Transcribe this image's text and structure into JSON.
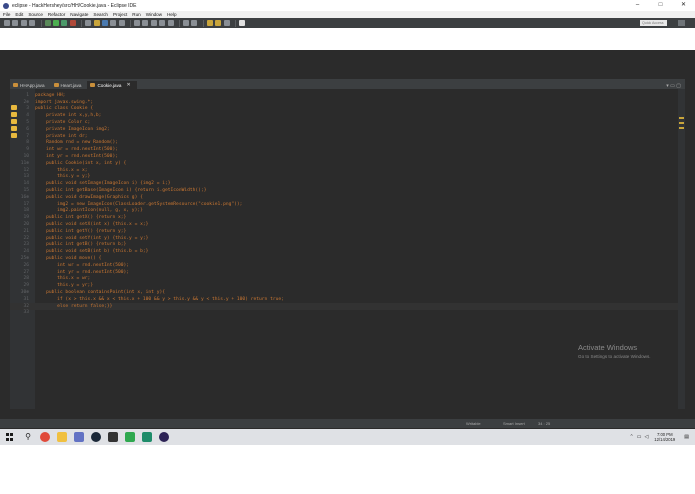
{
  "window": {
    "title": "eclipse - HackHershey/src/HH/Cookie.java - Eclipse IDE",
    "minimize": "–",
    "maximize": "□",
    "close": "✕"
  },
  "menu": [
    "File",
    "Edit",
    "Source",
    "Refactor",
    "Navigate",
    "Search",
    "Project",
    "Run",
    "Window",
    "Help"
  ],
  "toolbar": {
    "quick_access": "Quick Access"
  },
  "tabs": [
    {
      "label": "HHApp.java",
      "active": false
    },
    {
      "label": "Heart.java",
      "active": false
    },
    {
      "label": "Cookie.java",
      "active": true,
      "close": "✕"
    }
  ],
  "tab_controls": "▾ ▭ ▢",
  "code_lines": [
    {
      "num": "1",
      "text": "package HH;"
    },
    {
      "num": "2⊕",
      "text": "import javax.swing.*;"
    },
    {
      "num": "3",
      "text": "public class Cookie {"
    },
    {
      "num": "4",
      "text": "    private int x,y,h,b;"
    },
    {
      "num": "5",
      "text": "    private Color c;"
    },
    {
      "num": "6",
      "text": "    private ImageIcon img2;"
    },
    {
      "num": "7",
      "text": "    private int dr;"
    },
    {
      "num": "8",
      "text": "    Random rnd = new Random();"
    },
    {
      "num": "9",
      "text": "    int wr = rnd.nextInt(500);"
    },
    {
      "num": "10",
      "text": "    int yr = rnd.nextInt(500);"
    },
    {
      "num": "11⊕",
      "text": "    public Cookie(int x, int y) {"
    },
    {
      "num": "12",
      "text": "        this.x = x;"
    },
    {
      "num": "13",
      "text": "        this.y = y;}"
    },
    {
      "num": "14",
      "text": "    public void setImage(ImageIcon i) {img2 = i;}"
    },
    {
      "num": "15",
      "text": "    public int getBase(ImageIcon i) {return i.getIconWidth();}"
    },
    {
      "num": "16⊕",
      "text": "    public void drawImage(Graphics g) {"
    },
    {
      "num": "17",
      "text": "        img2 = new ImageIcon(ClassLoader.getSystemResource(\"cookie1.png\"));"
    },
    {
      "num": "18",
      "text": "        img2.paintIcon(null, g, x, y);}"
    },
    {
      "num": "19",
      "text": "    public int getX() {return x;}"
    },
    {
      "num": "20",
      "text": "    public void setX(int x) {this.x = x;}"
    },
    {
      "num": "21",
      "text": "    public int getY() {return y;}"
    },
    {
      "num": "22",
      "text": "    public void setY(int y) {this.y = y;}"
    },
    {
      "num": "23",
      "text": "    public int getB() {return b;}"
    },
    {
      "num": "24",
      "text": "    public void setB(int b) {this.b = b;}"
    },
    {
      "num": "25⊕",
      "text": "    public void move() {"
    },
    {
      "num": "26",
      "text": "        int wr = rnd.nextInt(500);"
    },
    {
      "num": "27",
      "text": "        int yr = rnd.nextInt(500);"
    },
    {
      "num": "28",
      "text": "        this.x = wr;"
    },
    {
      "num": "29",
      "text": "        this.y = yr;}"
    },
    {
      "num": "30⊕",
      "text": "    public boolean containsPoint(int x, int y){"
    },
    {
      "num": "31",
      "text": "        if (x > this.x && x < this.x + 100 && y > this.y && y < this.y + 100) return true;"
    },
    {
      "num": "32",
      "text": "        else return false;}}"
    },
    {
      "num": "33",
      "text": ""
    }
  ],
  "watermark": {
    "title": "Activate Windows",
    "subtitle": "Go to Settings to activate Windows."
  },
  "status": {
    "writable": "Writable",
    "insert": "Smart Insert",
    "position": "34 : 25"
  },
  "clock": {
    "time": "7:00 PM",
    "date": "12/14/2019"
  },
  "colors": {
    "editor_bg": "#2b2b2b",
    "keyword": "#cc7832",
    "toolbar_bg": "#3c3f41"
  }
}
